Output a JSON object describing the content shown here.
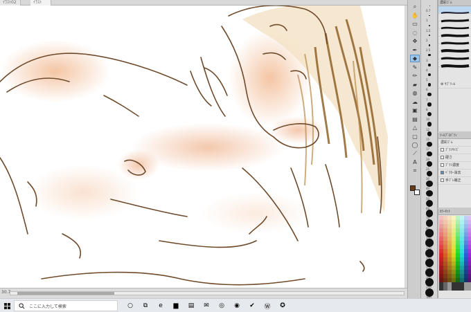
{
  "tabs": [
    {
      "label": "ｲﾗｽﾄ02"
    },
    {
      "label": "ｲﾗｽﾄ"
    }
  ],
  "status": {
    "zoom": "30.7"
  },
  "brush_panel": {
    "title": "濃彩ｺﾞﾑ",
    "sub_tool_label": "ｻﾌﾞﾂｰﾙ"
  },
  "tool_property": {
    "title": "ﾂｰﾙﾌﾟﾛﾊﾟﾃｨ",
    "subtitle": "濃彩ｺﾞﾑ",
    "rows": [
      {
        "label": "ﾌﾞﾗｼｻｲｽﾞ",
        "checked": false
      },
      {
        "label": "硬さ",
        "checked": false
      },
      {
        "label": "ﾌﾞﾗｼ濃度",
        "checked": false
      },
      {
        "label": "ﾍﾞｸﾀｰ消去",
        "checked": true
      },
      {
        "label": "手ﾌﾞﾚ補正",
        "checked": false
      }
    ]
  },
  "color_set": {
    "title": "ｶﾗｰｾｯﾄ"
  },
  "brush_sizes": [
    "0.7",
    "1",
    "1.5",
    "2",
    "2.5",
    "3",
    "4",
    "5",
    "6",
    "7",
    "8",
    "10",
    "12",
    "15",
    "17",
    "20",
    "25",
    "30",
    "40",
    "50",
    "60",
    "70",
    "80",
    "100",
    "120",
    "150",
    "170",
    "200",
    "250",
    "300"
  ],
  "colors": {
    "main": "#6b3a13",
    "sub": "#ffffff",
    "selection": "#9fc6ea"
  },
  "tools": [
    "zoom-icon",
    "hand-icon",
    "select-icon",
    "lasso-icon",
    "move-icon",
    "pen-icon",
    "eraser-icon",
    "brush-icon",
    "pencil-icon",
    "marker-icon",
    "airbrush-icon",
    "blend-icon",
    "fill-icon",
    "gradient-icon",
    "figure-icon",
    "frame-icon",
    "balloon-icon",
    "ruler-icon",
    "text-icon",
    "eyedropper-icon"
  ],
  "taskbar": {
    "search_placeholder": "ここに入力して検索",
    "apps": [
      "cortana-icon",
      "task-view-icon",
      "edge-icon",
      "files-icon",
      "store-icon",
      "mail-icon",
      "app-icon",
      "app2-icon",
      "check-icon",
      "app3-icon",
      "clip-studio-icon"
    ]
  }
}
